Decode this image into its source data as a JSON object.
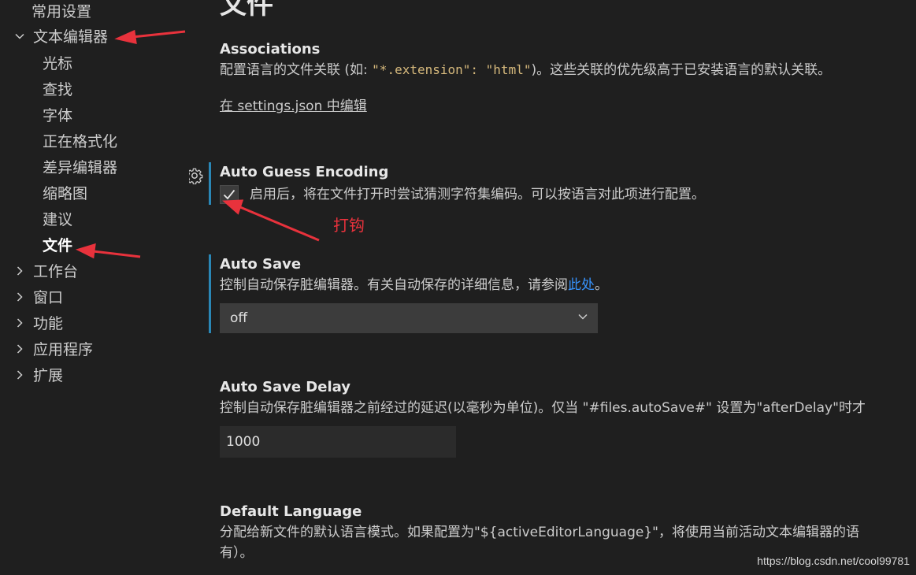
{
  "tree": {
    "items": [
      {
        "label": "常用设置",
        "level": 1,
        "chevron": ""
      },
      {
        "label": "文本编辑器",
        "level": 0,
        "chevron": "down"
      },
      {
        "label": "光标",
        "level": 1,
        "chevron": ""
      },
      {
        "label": "查找",
        "level": 1,
        "chevron": ""
      },
      {
        "label": "字体",
        "level": 1,
        "chevron": ""
      },
      {
        "label": "正在格式化",
        "level": 1,
        "chevron": ""
      },
      {
        "label": "差异编辑器",
        "level": 1,
        "chevron": ""
      },
      {
        "label": "缩略图",
        "level": 1,
        "chevron": ""
      },
      {
        "label": "建议",
        "level": 1,
        "chevron": ""
      },
      {
        "label": "文件",
        "level": 1,
        "chevron": "",
        "active": true
      },
      {
        "label": "工作台",
        "level": 0,
        "chevron": "right"
      },
      {
        "label": "窗口",
        "level": 0,
        "chevron": "right"
      },
      {
        "label": "功能",
        "level": 0,
        "chevron": "right"
      },
      {
        "label": "应用程序",
        "level": 0,
        "chevron": "right"
      },
      {
        "label": "扩展",
        "level": 0,
        "chevron": "right"
      }
    ]
  },
  "main": {
    "page_title": "文件",
    "associations": {
      "title": "Associations",
      "desc_prefix": "配置语言的文件关联 (如: ",
      "desc_code": "\"*.extension\": \"html\"",
      "desc_suffix": ")。这些关联的优先级高于已安装语言的默认关联。",
      "edit_link": "在 settings.json 中编辑"
    },
    "auto_guess_encoding": {
      "title": "Auto Guess Encoding",
      "checked": true,
      "checkbox_label": "启用后，将在文件打开时尝试猜测字符集编码。可以按语言对此项进行配置。"
    },
    "auto_save": {
      "title": "Auto Save",
      "desc_prefix": "控制自动保存脏编辑器。有关自动保存的详细信息，请参阅",
      "desc_link": "此处",
      "desc_suffix": "。",
      "value": "off"
    },
    "auto_save_delay": {
      "title": "Auto Save Delay",
      "desc": "控制自动保存脏编辑器之前经过的延迟(以毫秒为单位)。仅当 \"#files.autoSave#\" 设置为\"afterDelay\"时才",
      "value": "1000"
    },
    "default_language": {
      "title": "Default Language",
      "desc_line1": "分配给新文件的默认语言模式。如果配置为\"${activeEditorLanguage}\"，将使用当前活动文本编辑器的语",
      "desc_line2": "有）。"
    }
  },
  "annotation": {
    "label": "打钩",
    "color": "#e8323c"
  },
  "watermark": "https://blog.csdn.net/cool99781",
  "colors": {
    "background": "#1f1f1f",
    "modified_bar": "#2a87b6",
    "link": "#3794ff",
    "code": "#d7ba7d"
  }
}
